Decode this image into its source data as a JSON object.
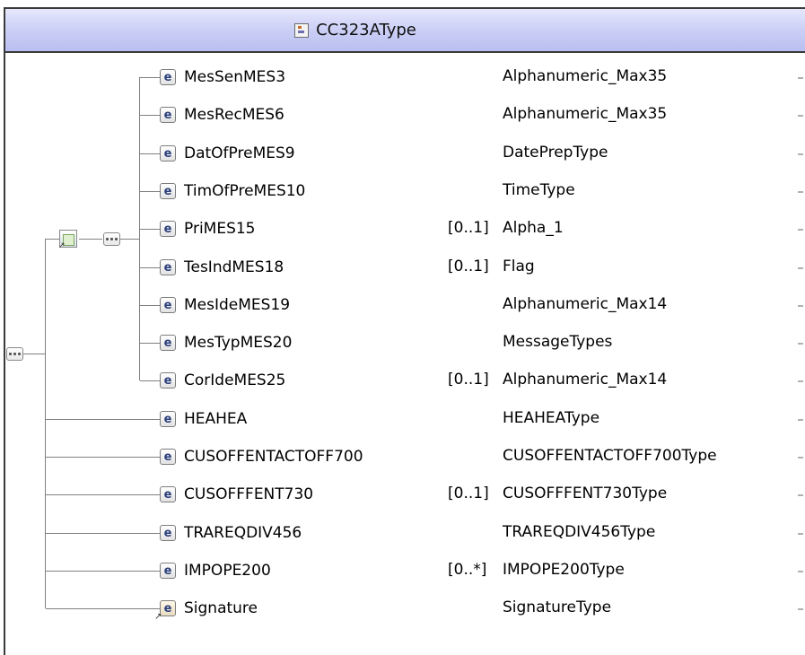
{
  "title": "CC323AType",
  "rows": [
    {
      "name": "MesSenMES3",
      "occurs": "",
      "type": "Alphanumeric_Max35"
    },
    {
      "name": "MesRecMES6",
      "occurs": "",
      "type": "Alphanumeric_Max35"
    },
    {
      "name": "DatOfPreMES9",
      "occurs": "",
      "type": "DatePrepType"
    },
    {
      "name": "TimOfPreMES10",
      "occurs": "",
      "type": "TimeType"
    },
    {
      "name": "PriMES15",
      "occurs": "[0..1]",
      "type": "Alpha_1"
    },
    {
      "name": "TesIndMES18",
      "occurs": "[0..1]",
      "type": "Flag"
    },
    {
      "name": "MesIdeMES19",
      "occurs": "",
      "type": "Alphanumeric_Max14"
    },
    {
      "name": "MesTypMES20",
      "occurs": "",
      "type": "MessageTypes"
    },
    {
      "name": "CorIdeMES25",
      "occurs": "[0..1]",
      "type": "Alphanumeric_Max14"
    },
    {
      "name": "HEAHEA",
      "occurs": "",
      "type": "HEAHEAType"
    },
    {
      "name": "CUSOFFENTACTOFF700",
      "occurs": "",
      "type": "CUSOFFENTACTOFF700Type"
    },
    {
      "name": "CUSOFFFENT730",
      "occurs": "[0..1]",
      "type": "CUSOFFFENT730Type"
    },
    {
      "name": "TRAREQDIV456",
      "occurs": "",
      "type": "TRAREQDIV456Type"
    },
    {
      "name": "IMPOPE200",
      "occurs": "[0..*]",
      "type": "IMPOPE200Type"
    },
    {
      "name": "Signature",
      "occurs": "",
      "type": "SignatureType"
    }
  ],
  "icons": {
    "title": "complex-type-icon",
    "element": "element-icon",
    "signature": "element-reference-icon",
    "sequence": "sequence-icon",
    "group": "group-reference-icon"
  },
  "icon_letter": "e"
}
